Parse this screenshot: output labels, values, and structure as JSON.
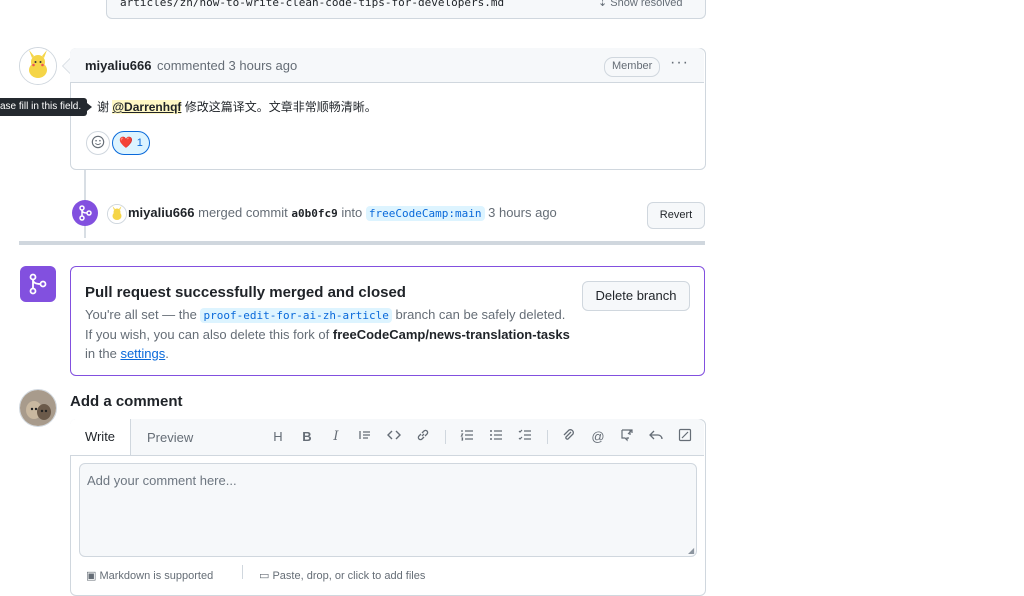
{
  "resolved_file": {
    "path": "articles/zh/how-to-write-clean-code-tips-for-developers.md",
    "show_resolved_label": "Show resolved"
  },
  "comment": {
    "author": "miyaliu666",
    "action_time": "commented 3 hours ago",
    "role_badge": "Member",
    "menu_glyph": "···",
    "tooltip": "ase fill in this field.",
    "body_prefix": "谢",
    "mention": "@Darrenhqf",
    "body_suffix": "修改这篇译文。文章非常顺畅清晰。",
    "reactions": [
      {
        "emoji": "❤️",
        "count": "1"
      }
    ]
  },
  "merge_event": {
    "author": "miyaliu666",
    "action": "merged commit",
    "sha": "a0b0fc9",
    "into_label": "into",
    "target_ref": "freeCodeCamp:main",
    "time": "3 hours ago",
    "revert_label": "Revert"
  },
  "merged_box": {
    "title": "Pull request successfully merged and closed",
    "line1_prefix": "You're all set — the",
    "branch": "proof-edit-for-ai-zh-article",
    "line1_suffix": "branch can be safely deleted.",
    "line2_prefix": "If you wish, you can also delete this fork of",
    "fork": "freeCodeCamp/news-translation-tasks",
    "line2_mid": "in the",
    "settings_link": "settings",
    "line2_end": ".",
    "delete_label": "Delete branch"
  },
  "add_comment": {
    "title": "Add a comment",
    "tab_write": "Write",
    "tab_preview": "Preview",
    "placeholder": "Add your comment here...",
    "markdown_note": "Markdown is supported",
    "attach_note": "Paste, drop, or click to add files"
  },
  "toolbar_icons": [
    "heading-icon",
    "bold-icon",
    "italic-icon",
    "quote-icon",
    "code-icon",
    "link-icon",
    "numbered-list-icon",
    "bulleted-list-icon",
    "task-list-icon",
    "attach-icon",
    "mention-icon",
    "cross-reference-icon",
    "reply-icon",
    "fullscreen-icon"
  ],
  "colors": {
    "merged_purple": "#8250df",
    "link_blue": "#0969da",
    "border": "#d0d7de",
    "mention_highlight": "#fff8c5"
  }
}
